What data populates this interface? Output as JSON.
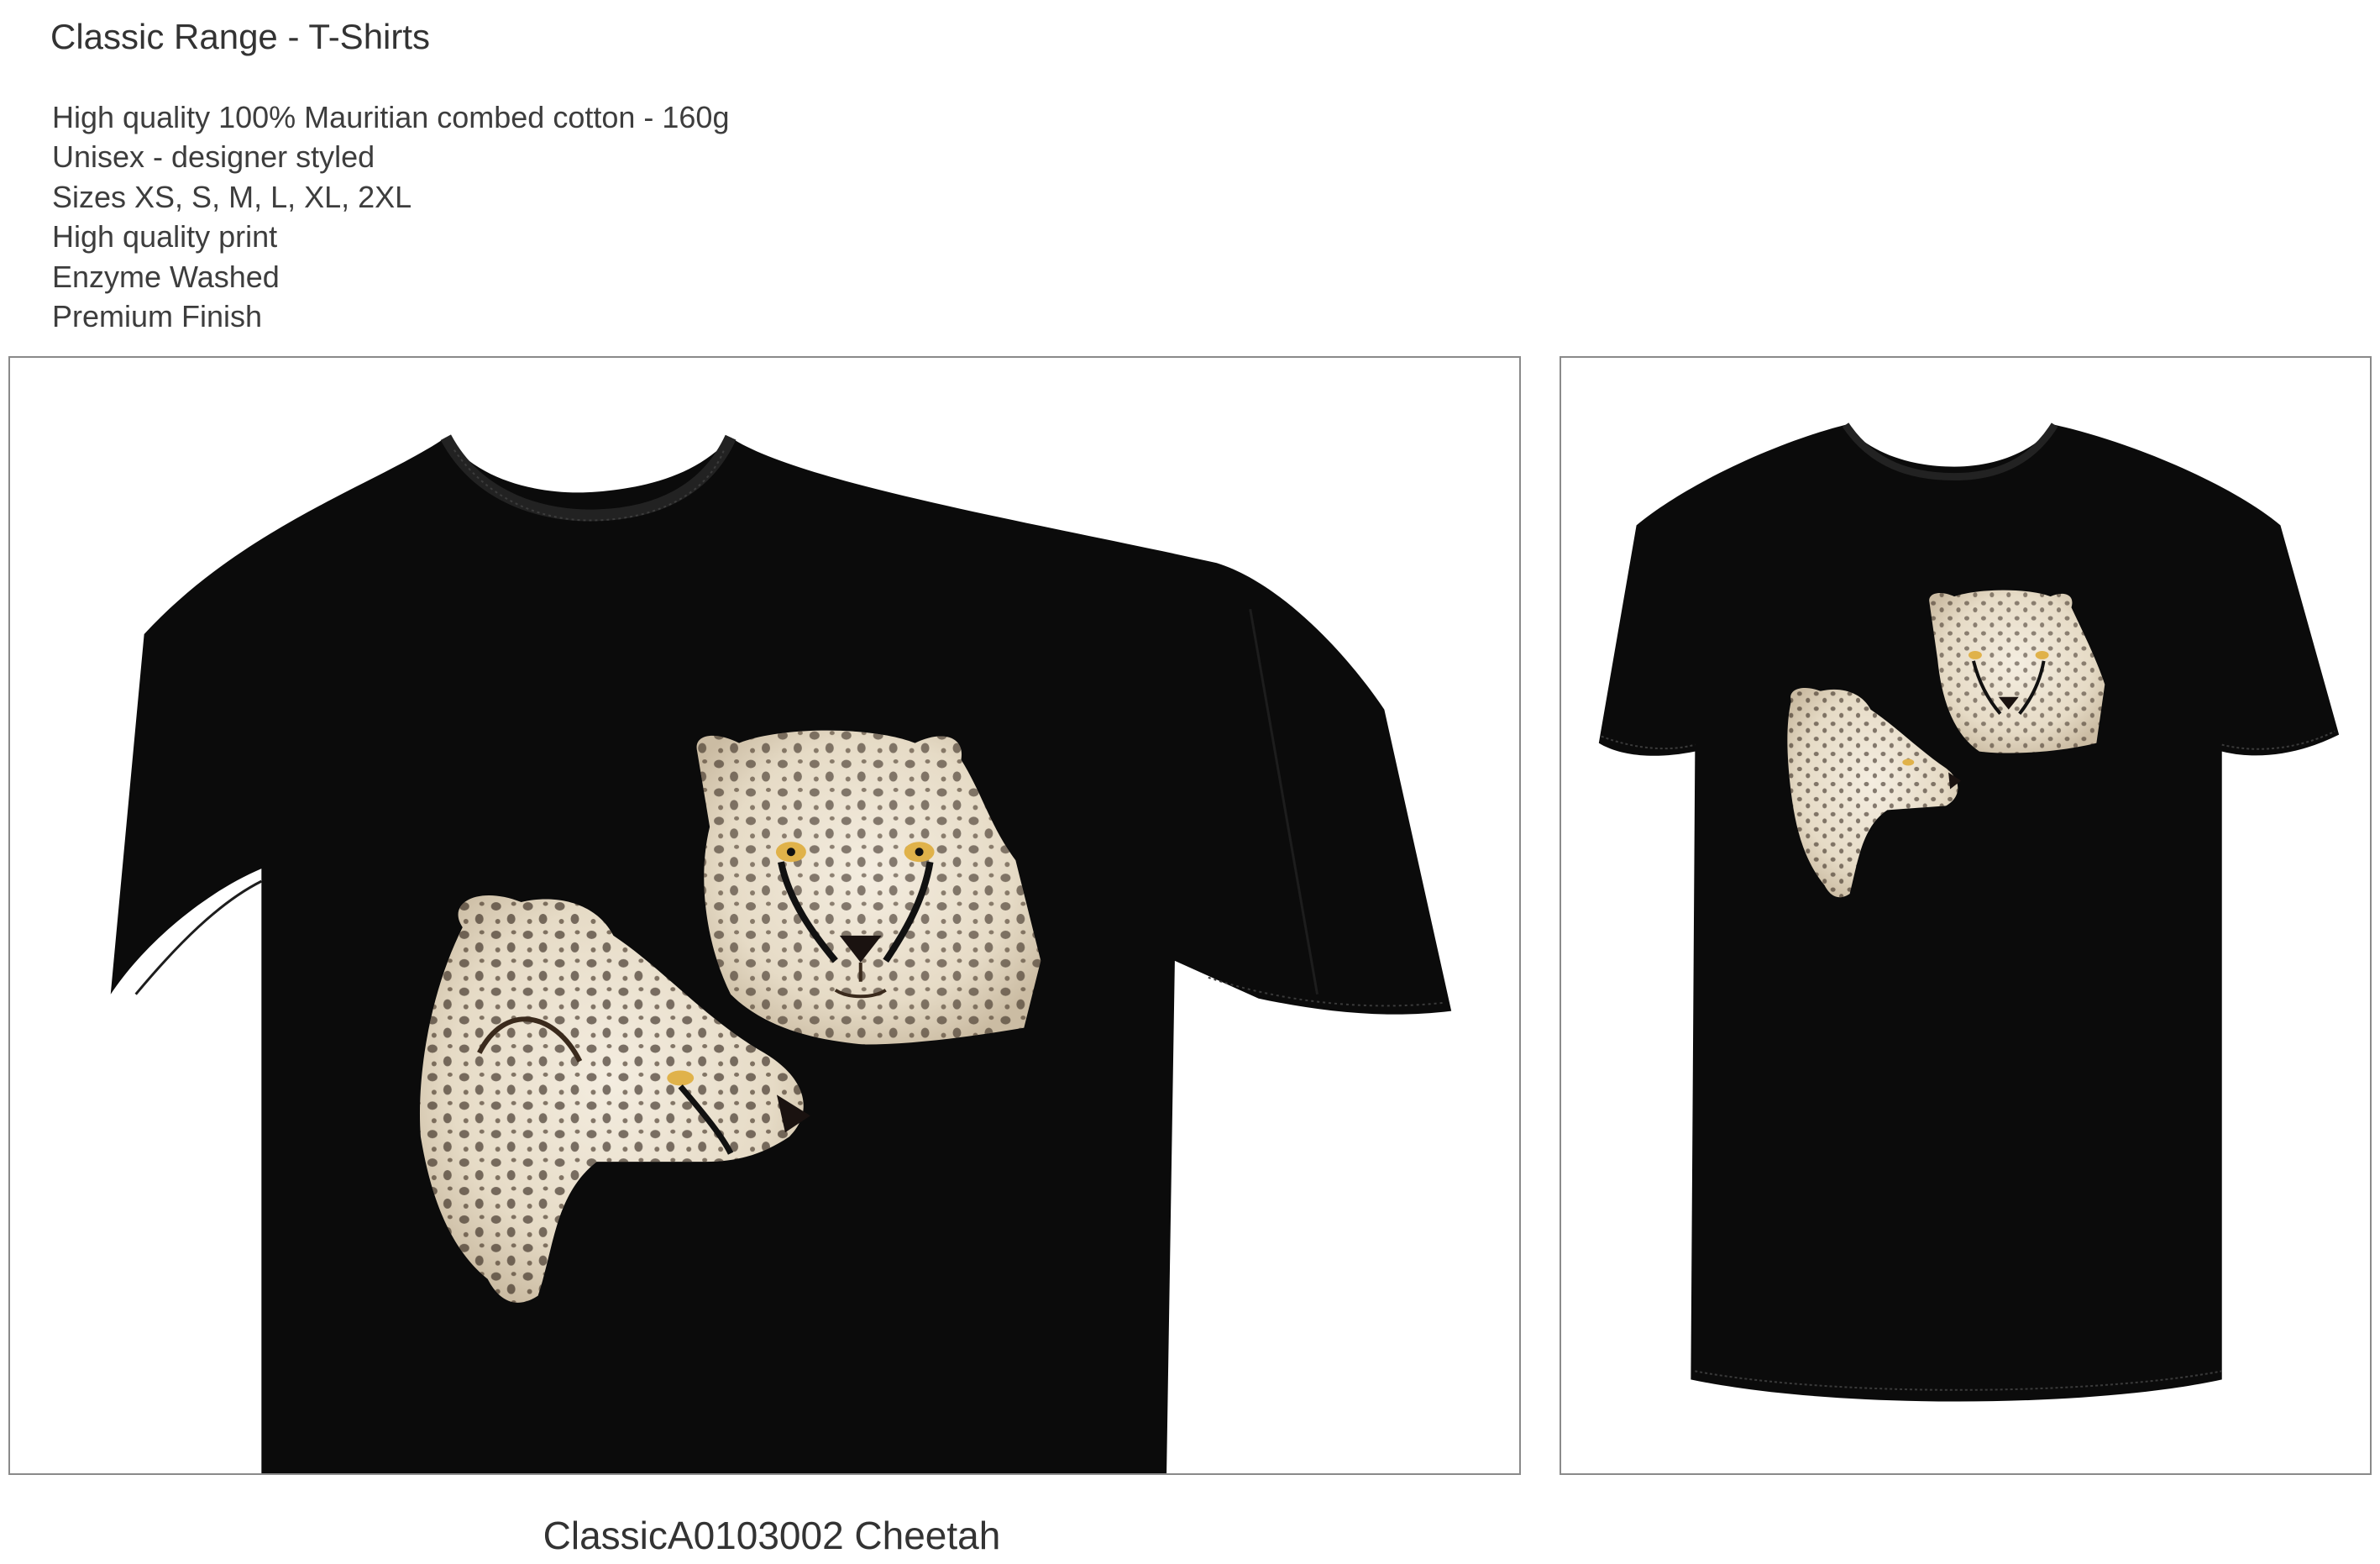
{
  "header": {
    "title": "Classic Range - T-Shirts"
  },
  "features": [
    "High quality 100% Mauritian combed cotton - 160g",
    "Unisex - designer styled",
    "Sizes XS, S, M, L, XL, 2XL",
    "High quality print",
    "Enzyme Washed",
    "Premium Finish"
  ],
  "product": {
    "caption": "ClassicA0103002 Cheetah",
    "shirt_color": "#0b0b0b",
    "print_base_color": "#e9e0d0",
    "spot_color": "#2a1d14"
  },
  "images": {
    "closeup": "closeup-shirt-image",
    "full": "full-shirt-image"
  }
}
